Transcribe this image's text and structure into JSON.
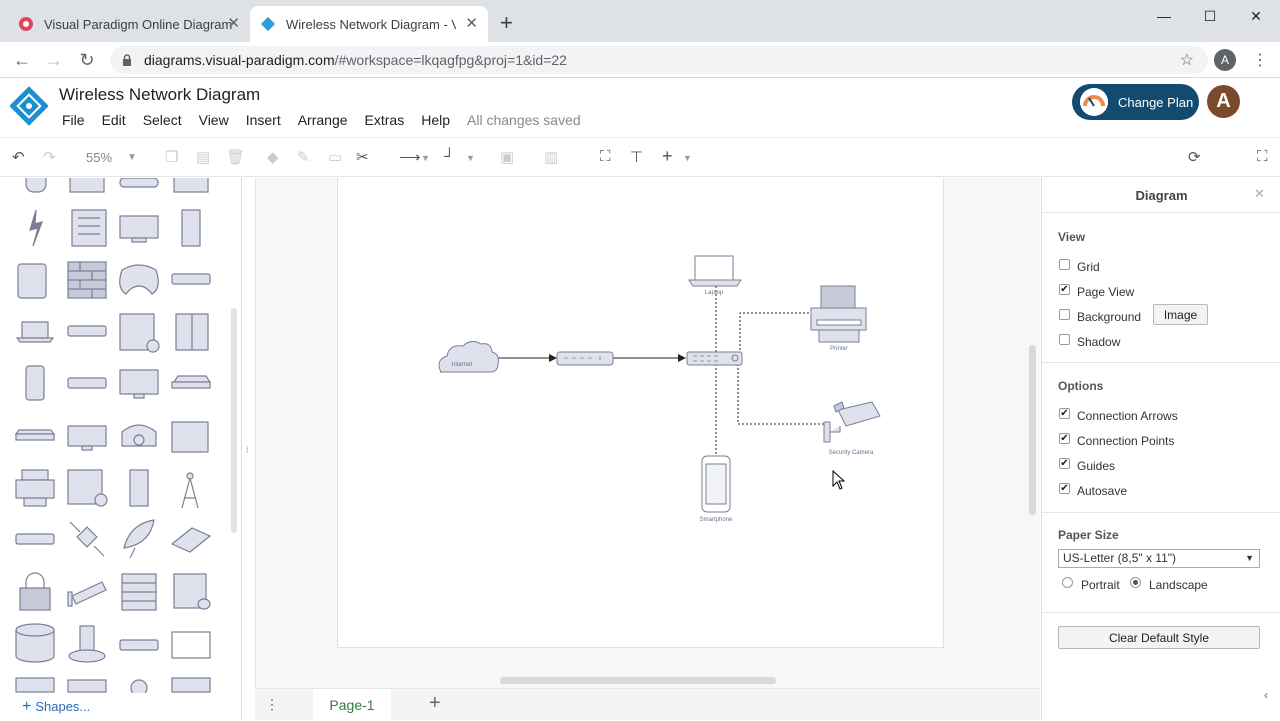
{
  "browser": {
    "tabs": [
      {
        "title": "Visual Paradigm Online Diagram",
        "active": false
      },
      {
        "title": "Wireless Network Diagram - VP (",
        "active": true
      }
    ],
    "new_tab": "+",
    "url_host": "diagrams.visual-paradigm.com",
    "url_path": "/#workspace=lkqagfpg&proj=1&id=22",
    "profile_initial": "A"
  },
  "app": {
    "title": "Wireless Network Diagram",
    "menu": [
      "File",
      "Edit",
      "Select",
      "View",
      "Insert",
      "Arrange",
      "Extras",
      "Help"
    ],
    "save_status": "All changes saved",
    "change_plan": "Change Plan",
    "avatar": "A"
  },
  "toolbar": {
    "zoom": "55%"
  },
  "left_panel": {
    "shapes_label": "Shapes..."
  },
  "diagram": {
    "nodes": [
      {
        "id": "internet",
        "label": "Internet"
      },
      {
        "id": "router",
        "label": ""
      },
      {
        "id": "switch",
        "label": ""
      },
      {
        "id": "laptop",
        "label": "Laptop"
      },
      {
        "id": "printer",
        "label": "Printer"
      },
      {
        "id": "camera",
        "label": "Security Camera"
      },
      {
        "id": "phone",
        "label": "Smartphone"
      }
    ],
    "page_tab": "Page-1",
    "add_page": "+"
  },
  "right_panel": {
    "title": "Diagram",
    "view_heading": "View",
    "view_options": [
      {
        "label": "Grid",
        "checked": false
      },
      {
        "label": "Page View",
        "checked": true
      },
      {
        "label": "Background",
        "checked": false
      },
      {
        "label": "Shadow",
        "checked": false
      }
    ],
    "image_button": "Image",
    "options_heading": "Options",
    "options": [
      {
        "label": "Connection Arrows",
        "checked": true
      },
      {
        "label": "Connection Points",
        "checked": true
      },
      {
        "label": "Guides",
        "checked": true
      },
      {
        "label": "Autosave",
        "checked": true
      }
    ],
    "paper_heading": "Paper Size",
    "paper_size": "US-Letter (8,5\" x 11\")",
    "orientation": [
      {
        "label": "Portrait",
        "selected": false
      },
      {
        "label": "Landscape",
        "selected": true
      }
    ],
    "clear_button": "Clear Default Style"
  },
  "colors": {
    "accent_green": "#2e7a3b",
    "brand_blue": "#134a6f",
    "shape_stroke": "#7a7f96",
    "shape_fill": "#dfe2ec"
  }
}
